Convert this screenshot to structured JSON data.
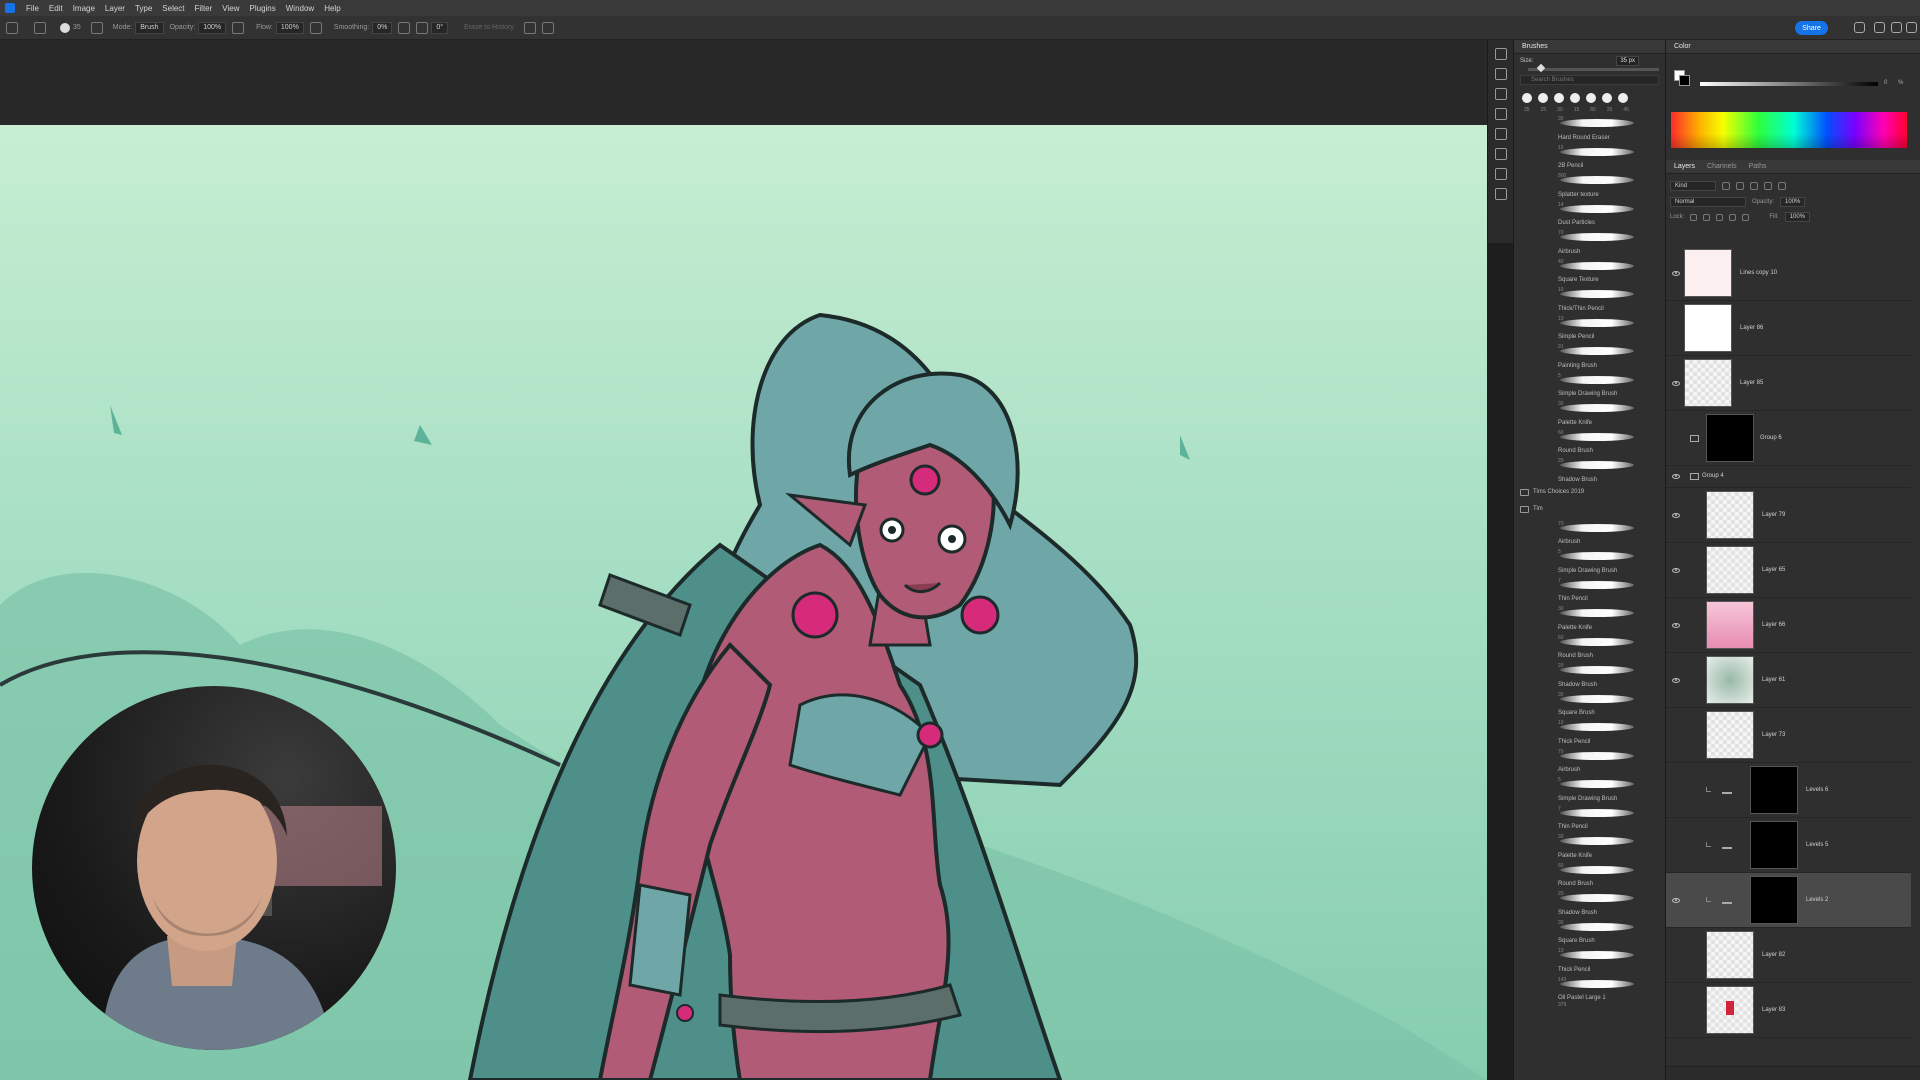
{
  "menu": [
    "File",
    "Edit",
    "Image",
    "Layer",
    "Type",
    "Select",
    "Filter",
    "View",
    "Plugins",
    "Window",
    "Help"
  ],
  "options": {
    "mode_label": "Mode:",
    "mode_value": "Brush",
    "opacity_label": "Opacity:",
    "opacity_value": "100%",
    "flow_label": "Flow:",
    "flow_value": "100%",
    "smoothing_label": "Smoothing:",
    "smoothing_value": "0%",
    "angle_value": "0°",
    "erase_label": "Erase to History",
    "brush_size_value": "35"
  },
  "share_label": "Share",
  "brushes": {
    "title": "Brushes",
    "size_label": "Size:",
    "size_value": "35 px",
    "search_placeholder": "Search Brushes",
    "recent_sizes": [
      "35",
      "25",
      "30",
      "15",
      "80",
      "20",
      "45"
    ],
    "items": [
      {
        "name": "Hard Round Eraser",
        "size": "30"
      },
      {
        "name": "2B Pencil",
        "size": "15"
      },
      {
        "name": "Splatter texture",
        "size": "800"
      },
      {
        "name": "Dust Particles",
        "size": "14"
      },
      {
        "name": "Airbrush",
        "size": "70"
      },
      {
        "name": "Square Texture",
        "size": "40"
      },
      {
        "name": "Thick/Thin Pencil",
        "size": "10"
      },
      {
        "name": "Simple Pencil",
        "size": "10"
      },
      {
        "name": "Painting Brush",
        "size": "91"
      },
      {
        "name": "Simple Drawing Brush",
        "size": "5"
      },
      {
        "name": "Palette Knife",
        "size": "30"
      },
      {
        "name": "Round Brush",
        "size": "60"
      },
      {
        "name": "Shadow Brush",
        "size": "20"
      }
    ],
    "groups": [
      "Tims Choices 2019",
      "Tim"
    ],
    "tim_items": [
      {
        "name": "Airbrush",
        "size": "70"
      },
      {
        "name": "Simple Drawing Brush",
        "size": "5"
      },
      {
        "name": "Thin Pencil",
        "size": "7"
      },
      {
        "name": "Palette Knife",
        "size": "30"
      },
      {
        "name": "Round Brush",
        "size": "60"
      },
      {
        "name": "Shadow Brush",
        "size": "20"
      },
      {
        "name": "Square Brush",
        "size": "30"
      },
      {
        "name": "Thick Pencil",
        "size": "10"
      },
      {
        "name": "Airbrush",
        "size": "70"
      },
      {
        "name": "Simple Drawing Brush",
        "size": "5"
      },
      {
        "name": "Thin Pencil",
        "size": "7"
      },
      {
        "name": "Palette Knife",
        "size": "30"
      },
      {
        "name": "Round Brush",
        "size": "60"
      },
      {
        "name": "Shadow Brush",
        "size": "20"
      },
      {
        "name": "Square Brush",
        "size": "30"
      },
      {
        "name": "Thick Pencil",
        "size": "10"
      },
      {
        "name": "Oil Pastel Large 1",
        "size": "143"
      }
    ],
    "last_size": "379"
  },
  "color": {
    "title": "Color",
    "value": "0",
    "unit": "%"
  },
  "layers": {
    "tabs": [
      "Layers",
      "Channels",
      "Paths"
    ],
    "kind_label": "Kind",
    "blend_mode": "Normal",
    "opacity_label": "Opacity:",
    "opacity_value": "100%",
    "lock_label": "Lock:",
    "fill_label": "Fill:",
    "fill_value": "100%",
    "items": [
      {
        "name": "Lines copy 10",
        "visible": true,
        "thumb": "sketch",
        "indent": 0
      },
      {
        "name": "Layer 86",
        "visible": false,
        "thumb": "white",
        "indent": 0
      },
      {
        "name": "Layer 85",
        "visible": true,
        "thumb": "checker",
        "indent": 0
      },
      {
        "name": "Group 6",
        "visible": false,
        "thumb": "silhouette",
        "indent": 0,
        "group": true
      },
      {
        "name": "Group 4",
        "visible": true,
        "thumb": "",
        "indent": 0,
        "group": true,
        "open": true
      },
      {
        "name": "Layer 79",
        "visible": true,
        "thumb": "checker",
        "indent": 1
      },
      {
        "name": "Layer 65",
        "visible": true,
        "thumb": "checker",
        "indent": 1
      },
      {
        "name": "Layer 66",
        "visible": true,
        "thumb": "pink",
        "indent": 1
      },
      {
        "name": "Layer 61",
        "visible": true,
        "thumb": "green",
        "indent": 1
      },
      {
        "name": "Layer 73",
        "visible": false,
        "thumb": "figure",
        "indent": 1
      },
      {
        "name": "Levels 6",
        "visible": false,
        "thumb": "mask",
        "indent": 2
      },
      {
        "name": "Levels 5",
        "visible": false,
        "thumb": "mask",
        "indent": 2
      },
      {
        "name": "Levels 2",
        "visible": true,
        "thumb": "mask",
        "indent": 2,
        "selected": true
      },
      {
        "name": "Layer 82",
        "visible": false,
        "thumb": "checker",
        "indent": 1
      },
      {
        "name": "Layer 83",
        "visible": false,
        "thumb": "red",
        "indent": 1
      }
    ]
  }
}
